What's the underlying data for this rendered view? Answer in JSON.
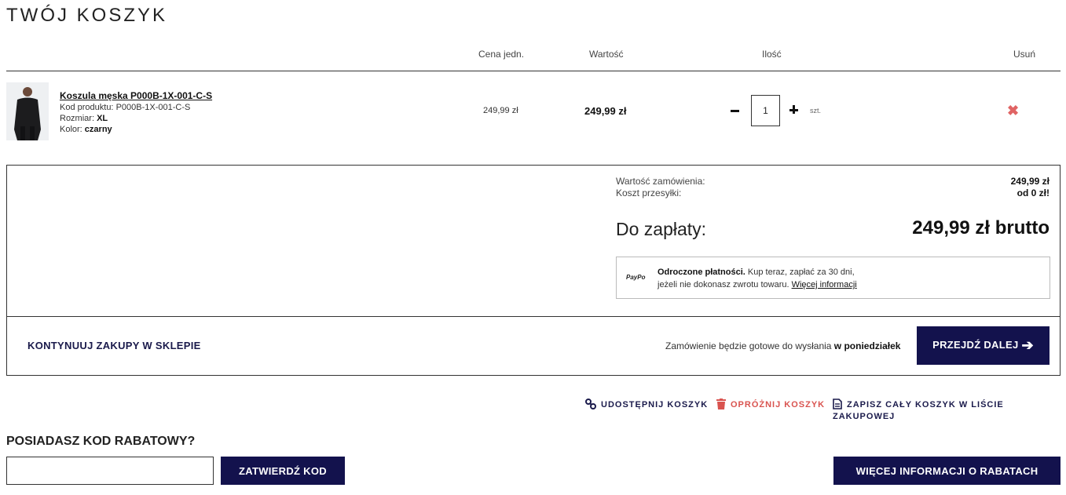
{
  "page_title": "TWÓJ KOSZYK",
  "cart_header": {
    "unit_price": "Cena jedn.",
    "value": "Wartość",
    "quantity": "Ilość",
    "remove": "Usuń"
  },
  "item": {
    "name": "Koszula męska P000B-1X-001-C-S",
    "code_label": "Kod produktu: ",
    "code": "P000B-1X-001-C-S",
    "size_label": "Rozmiar: ",
    "size": "XL",
    "color_label": "Kolor: ",
    "color": "czarny",
    "unit_price": "249,99 zł",
    "value": "249,99 zł",
    "quantity": "1",
    "unit": "szt.",
    "remove_icon": "close-icon"
  },
  "summary": {
    "order_value_label": "Wartość zamówienia:",
    "shipping_label": "Koszt przesyłki:",
    "order_value": "249,99 zł",
    "shipping": "od 0 zł!",
    "to_pay_label": "Do zapłaty:",
    "to_pay": "249,99 zł brutto"
  },
  "paypo": {
    "logo": "PayPo",
    "bold": "Odroczone płatności.",
    "text1": " Kup teraz, zapłać za 30 dni,",
    "text2": "jeżeli nie dokonasz zwrotu towaru. ",
    "link": "Więcej informacji"
  },
  "footer": {
    "continue": "KONTYNUUJ ZAKUPY W SKLEPIE",
    "ready_text": "Zamówienie będzie gotowe do wysłania ",
    "ready_day": "w poniedziałek",
    "next": "PRZEJDŹ DALEJ"
  },
  "actions": {
    "share": "UDOSTĘPNIJ KOSZYK",
    "empty": "OPRÓŻNIJ KOSZYK",
    "save": "ZAPISZ CAŁY KOSZYK W LIŚCIE ZAKUPOWEJ"
  },
  "discount": {
    "title": "POSIADASZ KOD RABATOWY?",
    "input_value": "",
    "submit": "ZATWIERDŹ KOD",
    "more": "WIĘCEJ INFORMACJI O RABATACH"
  },
  "colors": {
    "brand": "#13124d",
    "danger": "#d9534f",
    "remove": "#e06464"
  }
}
